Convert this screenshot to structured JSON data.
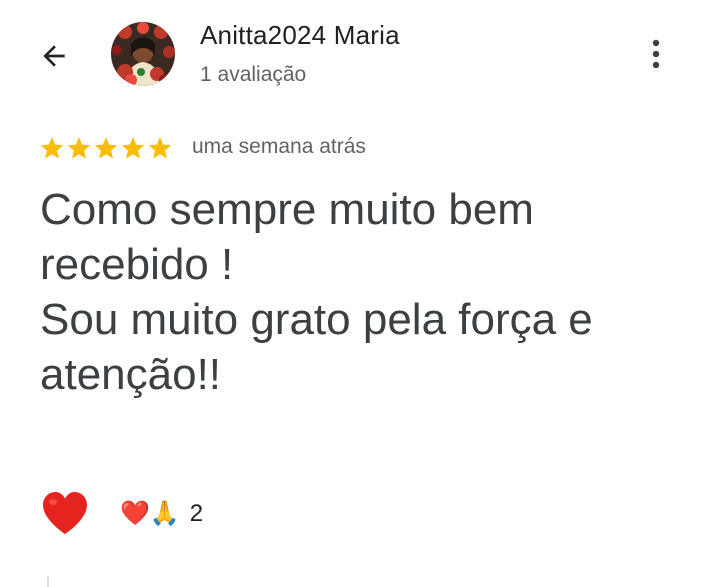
{
  "header": {
    "back_icon": "arrow-back-icon",
    "avatar_icon": "user-avatar",
    "user_name": "Anitta2024 Maria",
    "review_count": "1 avaliação",
    "more_icon": "more-vert-icon"
  },
  "review": {
    "rating": 5,
    "max_rating": 5,
    "star_color": "#fbbc04",
    "date": "uma semana atrás",
    "text": "Como sempre muito bem\nrecebido !\nSou muito grato pela força e\natenção!!"
  },
  "reactions": {
    "react_icon": "red-heart-icon",
    "summary_emojis": "❤️🙏",
    "count": "2"
  }
}
